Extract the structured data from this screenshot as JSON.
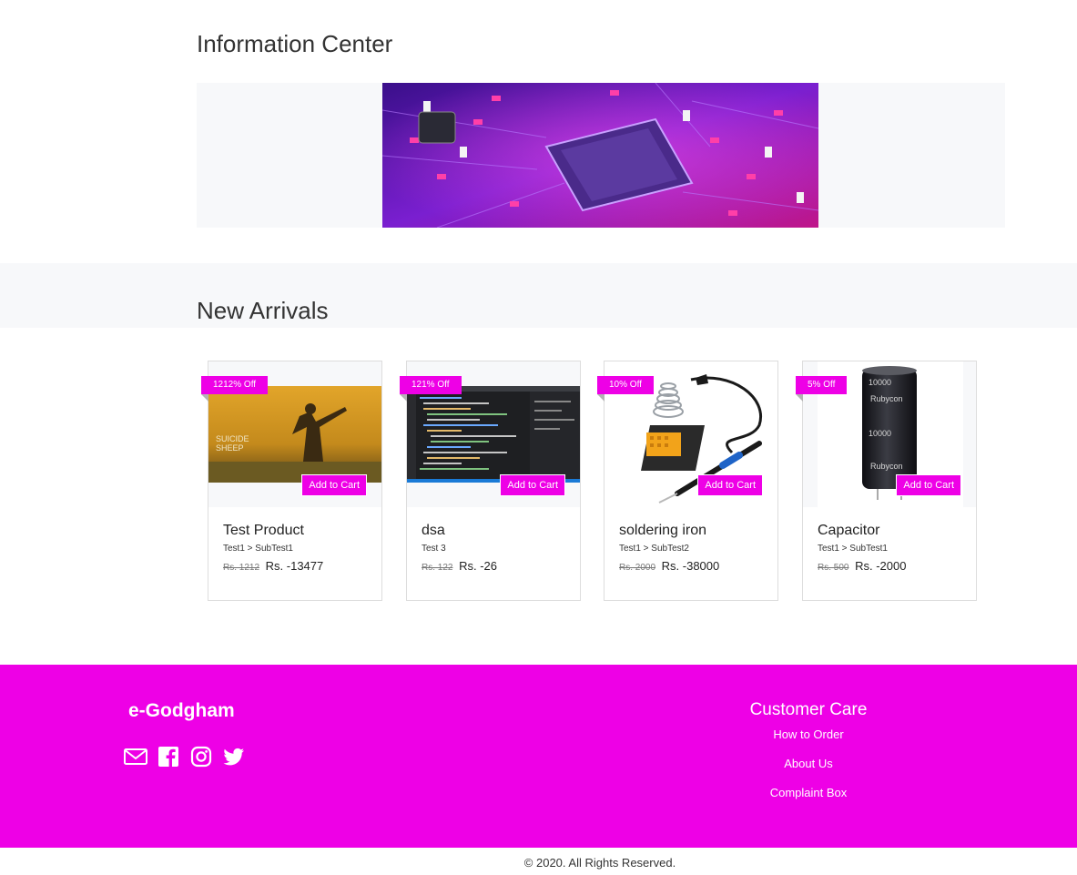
{
  "info_center": {
    "title": "Information Center"
  },
  "new_arrivals": {
    "title": "New Arrivals",
    "products": [
      {
        "badge": "1212% Off",
        "cart_label": "Add to Cart",
        "name": "Test Product",
        "category": "Test1 > SubTest1",
        "old_price": "Rs. 1212",
        "price": "Rs. -13477"
      },
      {
        "badge": "121% Off",
        "cart_label": "Add to Cart",
        "name": "dsa",
        "category": "Test 3",
        "old_price": "Rs. 122",
        "price": "Rs. -26"
      },
      {
        "badge": "10% Off",
        "cart_label": "Add to Cart",
        "name": "soldering iron",
        "category": "Test1 > SubTest2",
        "old_price": "Rs. 2000",
        "price": "Rs. -38000"
      },
      {
        "badge": "5% Off",
        "cart_label": "Add to Cart",
        "name": "Capacitor",
        "category": "Test1 > SubTest1",
        "old_price": "Rs. 500",
        "price": "Rs. -2000"
      }
    ]
  },
  "footer": {
    "brand": "e-Godgham",
    "social_icons": [
      "mail-icon",
      "facebook-icon",
      "instagram-icon",
      "twitter-icon"
    ],
    "customer_care": {
      "title": "Customer Care",
      "links": [
        "How to Order",
        "About Us",
        "Complaint Box"
      ]
    }
  },
  "copyright": "© 2020. All Rights Reserved.",
  "colors": {
    "accent": "#ee00e6",
    "band": "#f7f8fa"
  }
}
